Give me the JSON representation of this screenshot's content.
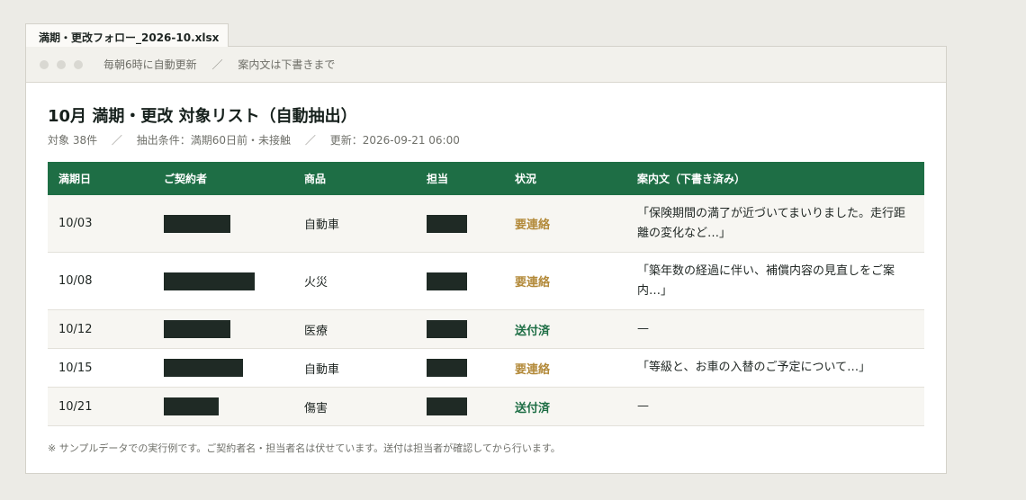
{
  "tab": {
    "filename": "満期・更改フォロー_2026-10.xlsx"
  },
  "toolbar": {
    "note1": "毎朝6時に自動更新",
    "separator": "／",
    "note2": "案内文は下書きまで"
  },
  "header": {
    "title": "10月 満期・更改 対象リスト（自動抽出）",
    "count": "対象 38件",
    "condition": "抽出条件：満期60日前・未接触",
    "updated": "更新：2026-09-21 06:00",
    "separator": "／"
  },
  "table": {
    "columns": [
      "満期日",
      "ご契約者",
      "商品",
      "担当",
      "状況",
      "案内文（下書き済み）"
    ],
    "rows": [
      {
        "date": "10/03",
        "product": "自動車",
        "status": "要連絡",
        "status_type": "warn",
        "message": "「保険期間の満了が近づいてまいりました。走行距離の変化など…」"
      },
      {
        "date": "10/08",
        "product": "火災",
        "status": "要連絡",
        "status_type": "warn",
        "message": "「築年数の経過に伴い、補償内容の見直しをご案内…」"
      },
      {
        "date": "10/12",
        "product": "医療",
        "status": "送付済",
        "status_type": "ok",
        "message": "—"
      },
      {
        "date": "10/15",
        "product": "自動車",
        "status": "要連絡",
        "status_type": "warn",
        "message": "「等級と、お車の入替のご予定について…」"
      },
      {
        "date": "10/21",
        "product": "傷害",
        "status": "送付済",
        "status_type": "ok",
        "message": "—"
      }
    ]
  },
  "footnote": "※ サンプルデータでの実行例です。ご契約者名・担当者名は伏せています。送付は担当者が確認してから行います。",
  "colors": {
    "header_green": "#1e6e45",
    "status_warn": "#b38a3a",
    "status_ok": "#1e6e45",
    "redaction": "#1f2a25"
  }
}
